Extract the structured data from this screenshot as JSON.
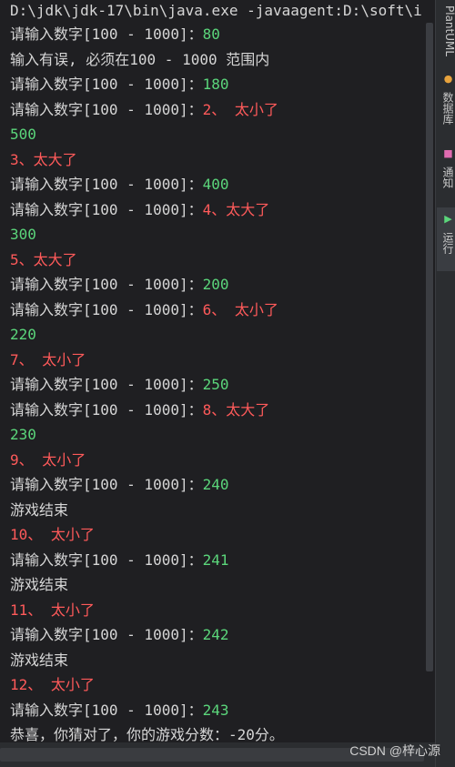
{
  "window": {
    "command": "D:\\jdk\\jdk-17\\bin\\java.exe -javaagent:D:\\soft\\i"
  },
  "console_lines": [
    {
      "prompt": "请输入数字[100 - 1000]：",
      "value": "80",
      "value_color": "green"
    },
    {
      "text": "输入有误, 必须在100 - 1000 范围内",
      "color": "plain"
    },
    {
      "prompt": "请输入数字[100 - 1000]：",
      "value": "180",
      "value_color": "green"
    },
    {
      "prompt": "请输入数字[100 - 1000]：",
      "value": "2、 太小了",
      "value_color": "red"
    },
    {
      "text": "500",
      "color": "green"
    },
    {
      "text": "3、太大了",
      "color": "red"
    },
    {
      "prompt": "请输入数字[100 - 1000]：",
      "value": "400",
      "value_color": "green"
    },
    {
      "prompt": "请输入数字[100 - 1000]：",
      "value": "4、太大了",
      "value_color": "red"
    },
    {
      "text": "300",
      "color": "green"
    },
    {
      "text": "5、太大了",
      "color": "red"
    },
    {
      "prompt": "请输入数字[100 - 1000]：",
      "value": "200",
      "value_color": "green"
    },
    {
      "prompt": "请输入数字[100 - 1000]：",
      "value": "6、 太小了",
      "value_color": "red"
    },
    {
      "text": "220",
      "color": "green"
    },
    {
      "text": "7、 太小了",
      "color": "red"
    },
    {
      "prompt": "请输入数字[100 - 1000]：",
      "value": "250",
      "value_color": "green"
    },
    {
      "prompt": "请输入数字[100 - 1000]：",
      "value": "8、太大了",
      "value_color": "red"
    },
    {
      "text": "230",
      "color": "green"
    },
    {
      "text": "9、 太小了",
      "color": "red"
    },
    {
      "prompt": "请输入数字[100 - 1000]：",
      "value": "240",
      "value_color": "green"
    },
    {
      "text": "游戏结束",
      "color": "plain"
    },
    {
      "text": "10、 太小了",
      "color": "red"
    },
    {
      "prompt": "请输入数字[100 - 1000]：",
      "value": "241",
      "value_color": "green"
    },
    {
      "text": "游戏结束",
      "color": "plain"
    },
    {
      "text": "11、 太小了",
      "color": "red"
    },
    {
      "prompt": "请输入数字[100 - 1000]：",
      "value": "242",
      "value_color": "green"
    },
    {
      "text": "游戏结束",
      "color": "plain"
    },
    {
      "text": "12、 太小了",
      "color": "red"
    },
    {
      "prompt": "请输入数字[100 - 1000]：",
      "value": "243",
      "value_color": "green"
    },
    {
      "text": "恭喜，你猜对了，你的游戏分数：-20分。",
      "color": "plain"
    }
  ],
  "sidebar": {
    "items": [
      {
        "label": "PlantUML",
        "icon": ""
      },
      {
        "label": "数据库",
        "icon": "database-icon"
      },
      {
        "label": "通知",
        "icon": "notification-icon"
      },
      {
        "label": "运行",
        "icon": "run-icon"
      }
    ]
  },
  "watermark": "CSDN @梓心源",
  "colors": {
    "green": "#5bd67b",
    "red": "#ff5a5a",
    "text": "#d6d6d6",
    "background": "#1f1f22"
  }
}
